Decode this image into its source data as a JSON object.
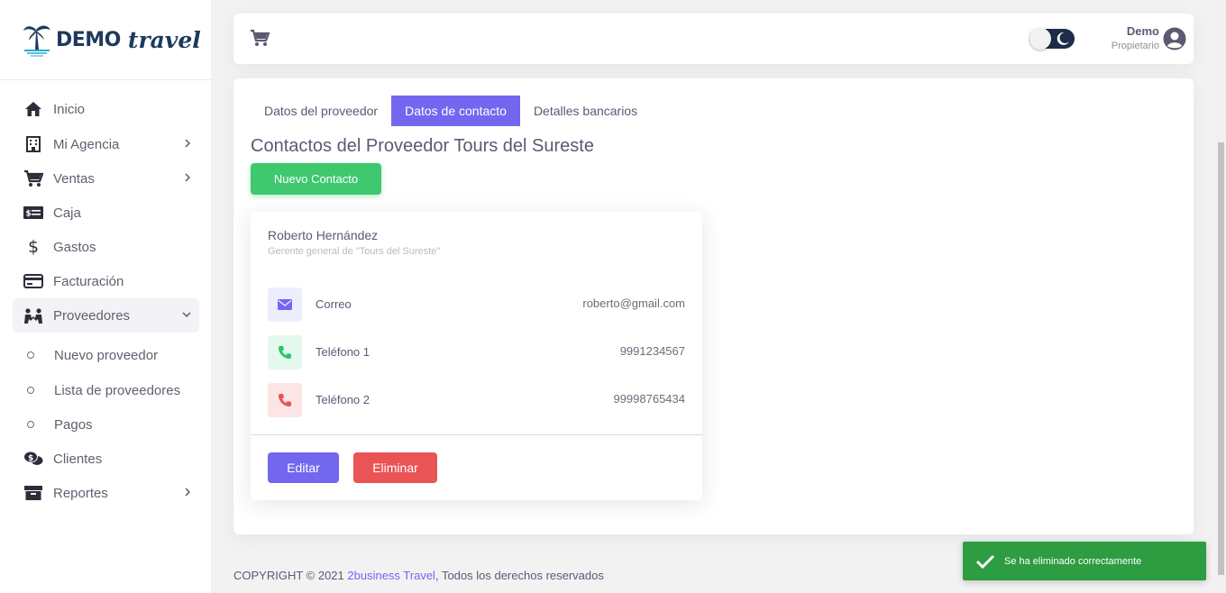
{
  "brand": {
    "name_part1": "DEMO",
    "name_part2": "travel"
  },
  "sidebar": {
    "items": [
      {
        "label": "Inicio",
        "icon": "home-icon"
      },
      {
        "label": "Mi Agencia",
        "icon": "building-icon"
      },
      {
        "label": "Ventas",
        "icon": "cart-icon"
      },
      {
        "label": "Caja",
        "icon": "cash-icon"
      },
      {
        "label": "Gastos",
        "icon": "dollar-icon"
      },
      {
        "label": "Facturación",
        "icon": "credit-card-icon"
      },
      {
        "label": "Proveedores",
        "icon": "people-icon"
      },
      {
        "label": "Clientes",
        "icon": "comments-dollar-icon"
      },
      {
        "label": "Reportes",
        "icon": "archive-icon"
      }
    ],
    "subitems": [
      {
        "label": "Nuevo proveedor"
      },
      {
        "label": "Lista de proveedores"
      },
      {
        "label": "Pagos"
      }
    ]
  },
  "navbar": {
    "user_name": "Demo",
    "user_role": "Propietario"
  },
  "tabs": [
    {
      "label": "Datos del proveedor"
    },
    {
      "label": "Datos de contacto"
    },
    {
      "label": "Detalles bancarios"
    }
  ],
  "main": {
    "title": "Contactos del Proveedor Tours del Sureste",
    "new_contact_label": "Nuevo Contacto"
  },
  "contact": {
    "name": "Roberto Hernández",
    "role": "Gerente general de \"Tours del Sureste\"",
    "rows": [
      {
        "label": "Correo",
        "value": "roberto@gmail.com",
        "color": "#7367f0"
      },
      {
        "label": "Teléfono 1",
        "value": "9991234567",
        "color": "#28c76f"
      },
      {
        "label": "Teléfono 2",
        "value": "99998765434",
        "color": "#ea5455"
      }
    ],
    "edit_label": "Editar",
    "delete_label": "Eliminar"
  },
  "footer": {
    "prefix": "COPYRIGHT © 2021 ",
    "link": "2business Travel",
    "suffix": ", Todos los derechos reservados"
  },
  "toast": {
    "message": "Se ha eliminado correctamente"
  },
  "colors": {
    "primary": "#7367f0",
    "success": "#28c76f",
    "danger": "#ea5455",
    "toast": "#2e9c40"
  }
}
